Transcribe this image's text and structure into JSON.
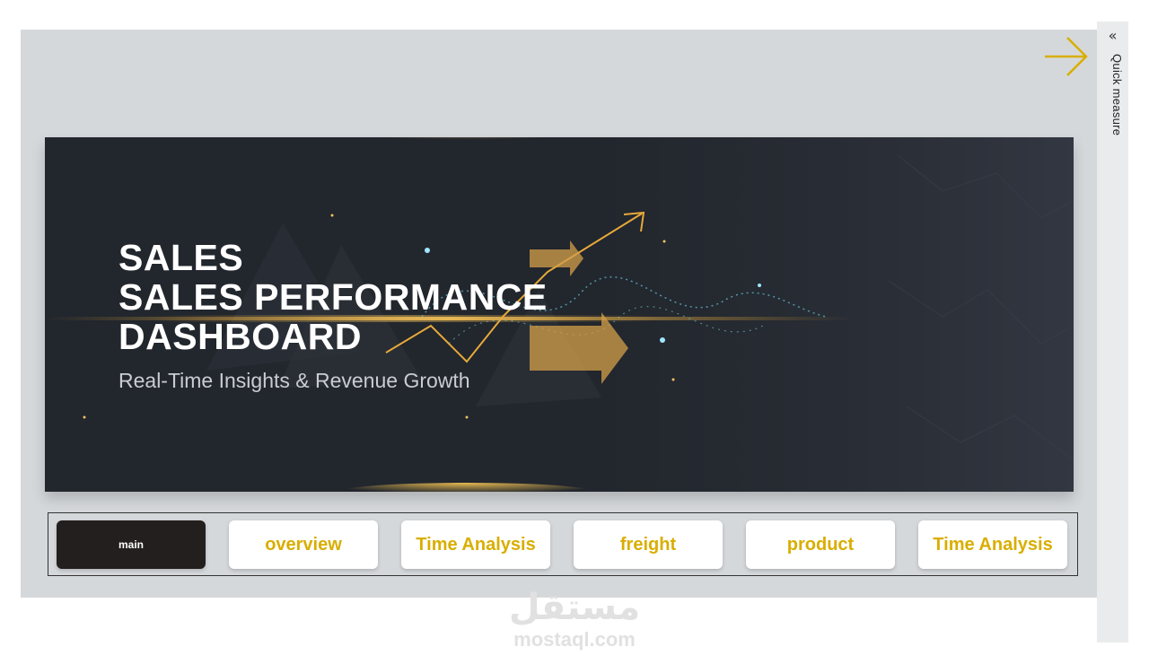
{
  "side_pane": {
    "label": "Quick measure",
    "collapse_glyph": "«",
    "collapse_icon": "double-chevron-left-icon"
  },
  "banner": {
    "line1": "SALES",
    "line2": "SALES PERFORMANCE",
    "line3": "DASHBOARD",
    "subtitle": "Real-Time Insights & Revenue Growth"
  },
  "nav": {
    "buttons": [
      {
        "label": "main",
        "active": true
      },
      {
        "label": "overview"
      },
      {
        "label": "Time Analysis"
      },
      {
        "label": "freight"
      },
      {
        "label": "product"
      },
      {
        "label": "Time Analysis"
      }
    ]
  },
  "watermark": {
    "arabic": "مستقل",
    "latin": "mostaql.com"
  },
  "colors": {
    "accent_gold": "#d9ae00",
    "active_button": "#231f1e",
    "banner_bg": "#23272f",
    "canvas_bg": "#d5d8db"
  }
}
